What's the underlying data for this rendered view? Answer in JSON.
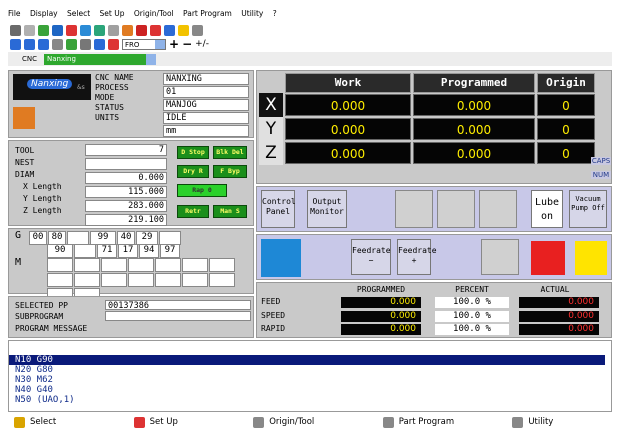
{
  "menu": [
    "File",
    "Display",
    "Select",
    "Set Up",
    "Origin/Tool",
    "Part Program",
    "Utility",
    "?"
  ],
  "toolbar": {
    "fro_label": "FRO",
    "plus": "+",
    "minus": "−",
    "pct": "+/-"
  },
  "cnc_bar": {
    "label": "CNC",
    "value": "Nanxing"
  },
  "logo": {
    "brand": "Nanxing",
    "suffix": "&s"
  },
  "info": {
    "labels": [
      "CNC NAME",
      "PROCESS",
      "MODE",
      "STATUS",
      "UNITS"
    ],
    "values": [
      "NANXING",
      "01",
      "MANJOG",
      "IDLE",
      "mm"
    ]
  },
  "tool": {
    "labels": [
      "TOOL",
      "NEST",
      "DIAM",
      "X Length",
      "Y Length",
      "Z Length"
    ],
    "values": [
      "7",
      "",
      "0.000",
      "115.000",
      "283.000",
      "219.100"
    ],
    "buttons": {
      "d_stop": "D Stop",
      "blk_del": "Blk Del",
      "dry_r": "Dry R",
      "f_byp": "F Byp",
      "rap_0": "Rap 0",
      "retr": "Retr",
      "man_s": "Man S"
    }
  },
  "gcodes": {
    "g_label": "G",
    "m_label": "M",
    "row1": [
      "00",
      "80",
      "",
      "99",
      "40",
      "29",
      ""
    ],
    "row2": [
      "90",
      "",
      "71",
      "17",
      "94",
      "97"
    ]
  },
  "pp": {
    "selected_label": "SELECTED PP",
    "selected_value": "00137386",
    "sub_label": "SUBPROGRAM",
    "msg_label": "PROGRAM MESSAGE"
  },
  "dro": {
    "headers": [
      "Work",
      "Programmed",
      "Origin"
    ],
    "rows": [
      {
        "axis": "X",
        "work": "0.000",
        "programmed": "0.000",
        "origin": "0"
      },
      {
        "axis": "Y",
        "work": "0.000",
        "programmed": "0.000",
        "origin": "0"
      },
      {
        "axis": "Z",
        "work": "0.000",
        "programmed": "0.000",
        "origin": "0"
      }
    ],
    "caps": "CAPS",
    "num": "NUM"
  },
  "softkeys": {
    "control_panel": "Control Panel",
    "output_monitor": "Output Monitor",
    "lube_on": "Lube on",
    "vacuum_pump_off": "Vacuum Pump Off",
    "feedrate_minus": "Feedrate −",
    "feedrate_plus": "Feedrate +"
  },
  "rates": {
    "headers": [
      "PROGRAMMED",
      "PERCENT",
      "ACTUAL"
    ],
    "rows": [
      {
        "label": "FEED",
        "programmed": "0.000",
        "percent": "100.0 %",
        "actual": "0.000"
      },
      {
        "label": "SPEED",
        "programmed": "0.000",
        "percent": "100.0 %",
        "actual": "0.000"
      },
      {
        "label": "RAPID",
        "programmed": "0.000",
        "percent": "100.0 %",
        "actual": "0.000"
      }
    ]
  },
  "program_lines": [
    "N10 G90",
    "N20 G80",
    "N30 M62",
    "N40 G40",
    "N50 (UAO,1)"
  ],
  "bottom": [
    "Select",
    "Set Up",
    "Origin/Tool",
    "Part Program",
    "Utility"
  ],
  "colors": {
    "accent": "#ffee00",
    "bg_dark": "#050505",
    "green_btn": "#1b8f1b",
    "selection": "#0a1a7a"
  }
}
